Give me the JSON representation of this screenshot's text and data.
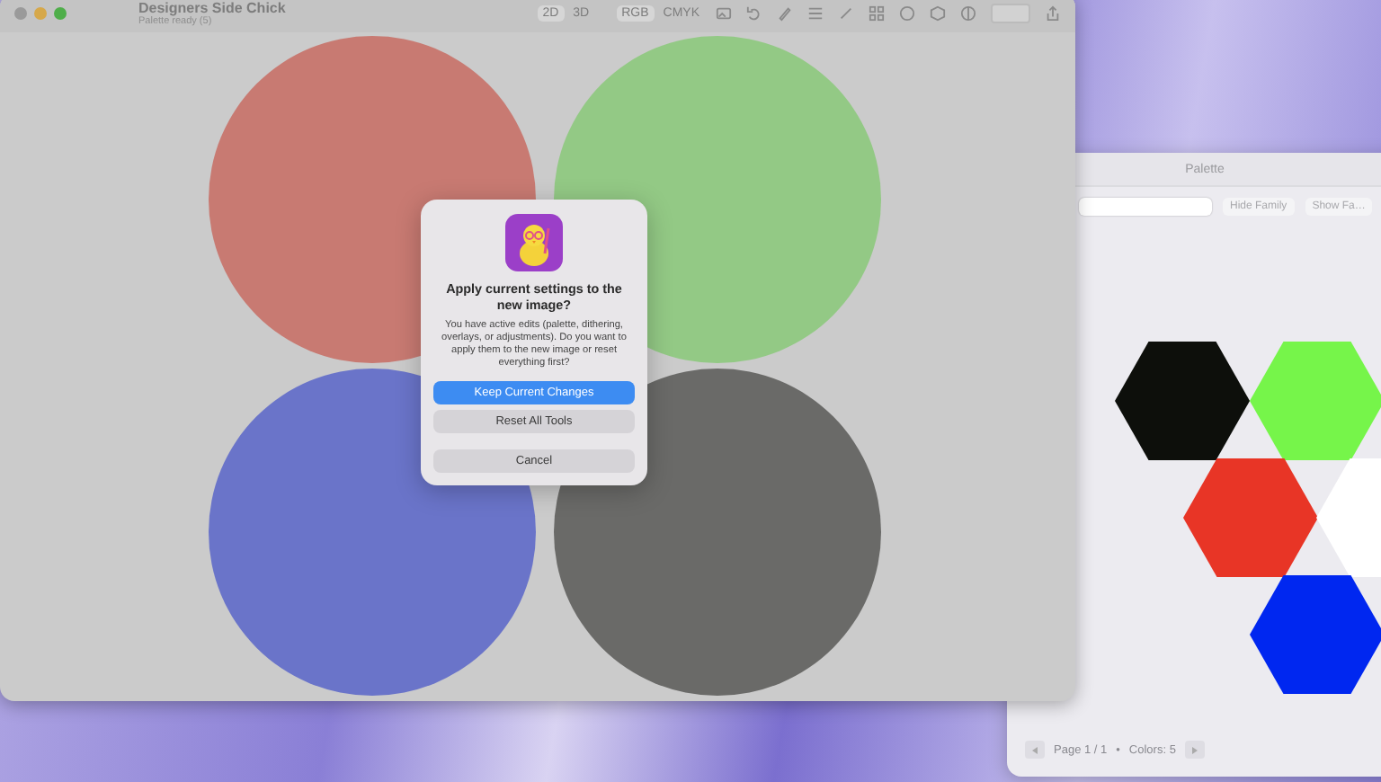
{
  "main_window": {
    "title": "Designers Side Chick",
    "subtitle": "Palette ready (5)",
    "view_modes": [
      {
        "label": "2D",
        "selected": true
      },
      {
        "label": "3D",
        "selected": false
      }
    ],
    "color_modes": [
      {
        "label": "RGB",
        "selected": true
      },
      {
        "label": "CMYK",
        "selected": false
      }
    ],
    "circles": [
      {
        "color": "#c87a72"
      },
      {
        "color": "#93c985"
      },
      {
        "color": "#6a74c9"
      },
      {
        "color": "#6a6a68"
      }
    ]
  },
  "dialog": {
    "title": "Apply current settings to the new image?",
    "message": "You have active edits (palette, dithering, overlays, or adjustments). Do you want to apply them to the new image or reset everything first?",
    "buttons": [
      {
        "label": "Keep Current Changes",
        "kind": "primary"
      },
      {
        "label": "Reset All Tools",
        "kind": "secondary"
      },
      {
        "label": "Cancel",
        "kind": "cancel"
      }
    ]
  },
  "palette_window": {
    "title": "Palette",
    "buttons": [
      "Hide Family",
      "Show Fa…"
    ],
    "swatches": [
      {
        "color": "#0d0f0b"
      },
      {
        "color": "#76f54a"
      },
      {
        "color": "#e83526"
      },
      {
        "color": "#ffffff"
      },
      {
        "color": "#0027f0"
      }
    ],
    "footer": {
      "page": "Page 1 / 1",
      "separator": "•",
      "count": "Colors: 5"
    }
  }
}
